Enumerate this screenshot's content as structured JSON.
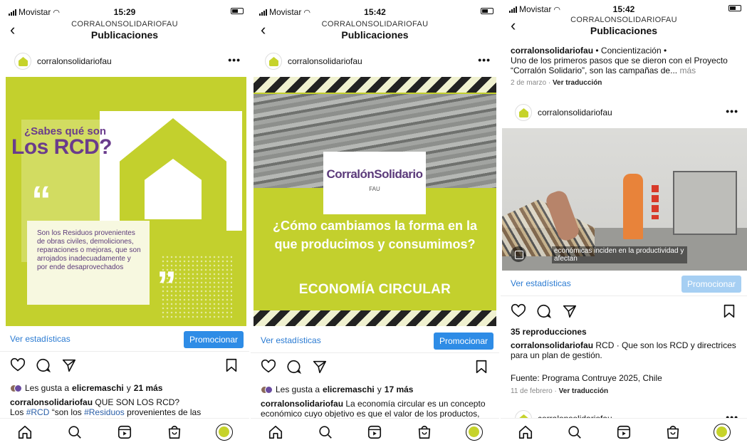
{
  "status_bars": [
    {
      "carrier": "Movistar",
      "time": "15:29"
    },
    {
      "carrier": "Movistar",
      "time": "15:42"
    },
    {
      "carrier": "Movistar",
      "time": "15:42"
    }
  ],
  "header": {
    "account": "CORRALONSOLIDARIOFAU",
    "title": "Publicaciones"
  },
  "post1": {
    "username": "corralonsolidariofau",
    "image": {
      "question_line1": "¿Sabes qué son",
      "question_line2": "Los RCD?",
      "quote_open": "“",
      "quote_close": "”",
      "definition": "Son los Residuos provenientes de obras civiles, demoliciones, reparaciones o mejoras, que son arrojados inadecuadamente y por ende desaprovechados"
    },
    "stats_link": "Ver estadísticas",
    "promote": "Promocionar",
    "likes_prefix": "Les gusta a",
    "likes_user": "elicremaschi",
    "likes_joiner": "y",
    "likes_count": "21 más",
    "caption_user": "corralonsolidariofau",
    "caption_text": "QUE SON LOS RCD?",
    "caption_line2_prefix": "Los",
    "caption_hashtag1": "#RCD",
    "caption_line2_mid": "“son los",
    "caption_hashtag2": "#Residuos",
    "caption_line2_end": "provenientes de las"
  },
  "post2": {
    "username": "corralonsolidariofau",
    "image": {
      "logo_main": "CorralónSolidario",
      "logo_sub": "FAU",
      "headline": "¿Cómo cambiamos la forma en la que producimos y consumimos?",
      "tagline": "ECONOMÍA CIRCULAR"
    },
    "stats_link": "Ver estadísticas",
    "promote": "Promocionar",
    "likes_prefix": "Les gusta a",
    "likes_user": "elicremaschi",
    "likes_joiner": "y",
    "likes_count": "17 más",
    "caption_user": "corralonsolidariofau",
    "caption_text": "La economía circular es un concepto económico cuyo objetivo es que el valor de los productos,"
  },
  "post3": {
    "prev_caption_user": "corralonsolidariofau",
    "prev_caption_tags": "• Concientización •",
    "prev_caption_text": "Uno de los primeros pasos que se dieron con el Proyecto “Corralón Solidario”, son las campañas de...",
    "prev_more": "más",
    "prev_date": "2 de marzo",
    "prev_separator": "·",
    "prev_translate": "Ver traducción",
    "username": "corralonsolidariofau",
    "video_subtitle": "económicas inciden en la productividad y afectan",
    "stats_link": "Ver estadísticas",
    "promote": "Promocionar",
    "views": "35 reproducciones",
    "caption_user": "corralonsolidariofau",
    "caption_text": "RCD · Que son los RCD y directrices para un plan de gestión.",
    "source": "Fuente: Programa Contruye 2025, Chile",
    "date": "11 de febrero",
    "date_separator": "·",
    "translate": "Ver traducción",
    "next_username": "corralonsolidariofau"
  },
  "more_glyph": "•••",
  "back_glyph": "‹",
  "colors": {
    "brand_green": "#c3d02d",
    "brand_purple": "#5b3a7a",
    "link_blue": "#2b7bd2",
    "promote_blue": "#2e8ce6"
  },
  "icons": [
    "back-icon",
    "more-icon",
    "heart-icon",
    "comment-icon",
    "share-icon",
    "bookmark-icon",
    "home-icon",
    "search-icon",
    "reels-icon",
    "shop-icon",
    "profile-icon"
  ]
}
